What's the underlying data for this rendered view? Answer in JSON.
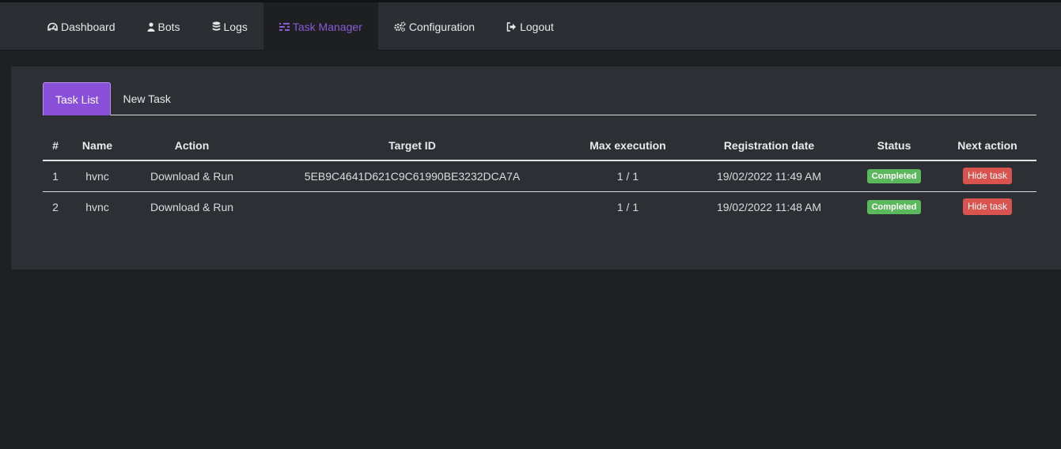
{
  "nav": {
    "items": [
      {
        "label": "Dashboard",
        "icon": "dashboard-icon"
      },
      {
        "label": "Bots",
        "icon": "user-icon"
      },
      {
        "label": "Logs",
        "icon": "database-icon"
      },
      {
        "label": "Task Manager",
        "icon": "tasks-icon"
      },
      {
        "label": "Configuration",
        "icon": "cogs-icon"
      },
      {
        "label": "Logout",
        "icon": "sign-out-icon"
      }
    ],
    "active": "Task Manager",
    "active_color": "#8a5bd6"
  },
  "tabs": {
    "items": [
      "Task List",
      "New Task"
    ],
    "active": "Task List"
  },
  "table": {
    "headers": [
      "#",
      "Name",
      "Action",
      "Target ID",
      "Max execution",
      "Registration date",
      "Status",
      "Next action"
    ],
    "rows": [
      {
        "id": "1",
        "name": "hvnc",
        "action": "Download & Run",
        "target_id": "5EB9C4641D621C9C61990BE3232DCA7A",
        "max_execution": "1 / 1",
        "registration_date": "19/02/2022 11:49 AM",
        "status": "Completed",
        "next_action": "Hide task"
      },
      {
        "id": "2",
        "name": "hvnc",
        "action": "Download & Run",
        "target_id": "",
        "max_execution": "1 / 1",
        "registration_date": "19/02/2022 11:48 AM",
        "status": "Completed",
        "next_action": "Hide task"
      }
    ]
  },
  "colors": {
    "status_completed": "#5cb85c",
    "hide_button": "#d9534f",
    "accent": "#8a4fd8"
  }
}
